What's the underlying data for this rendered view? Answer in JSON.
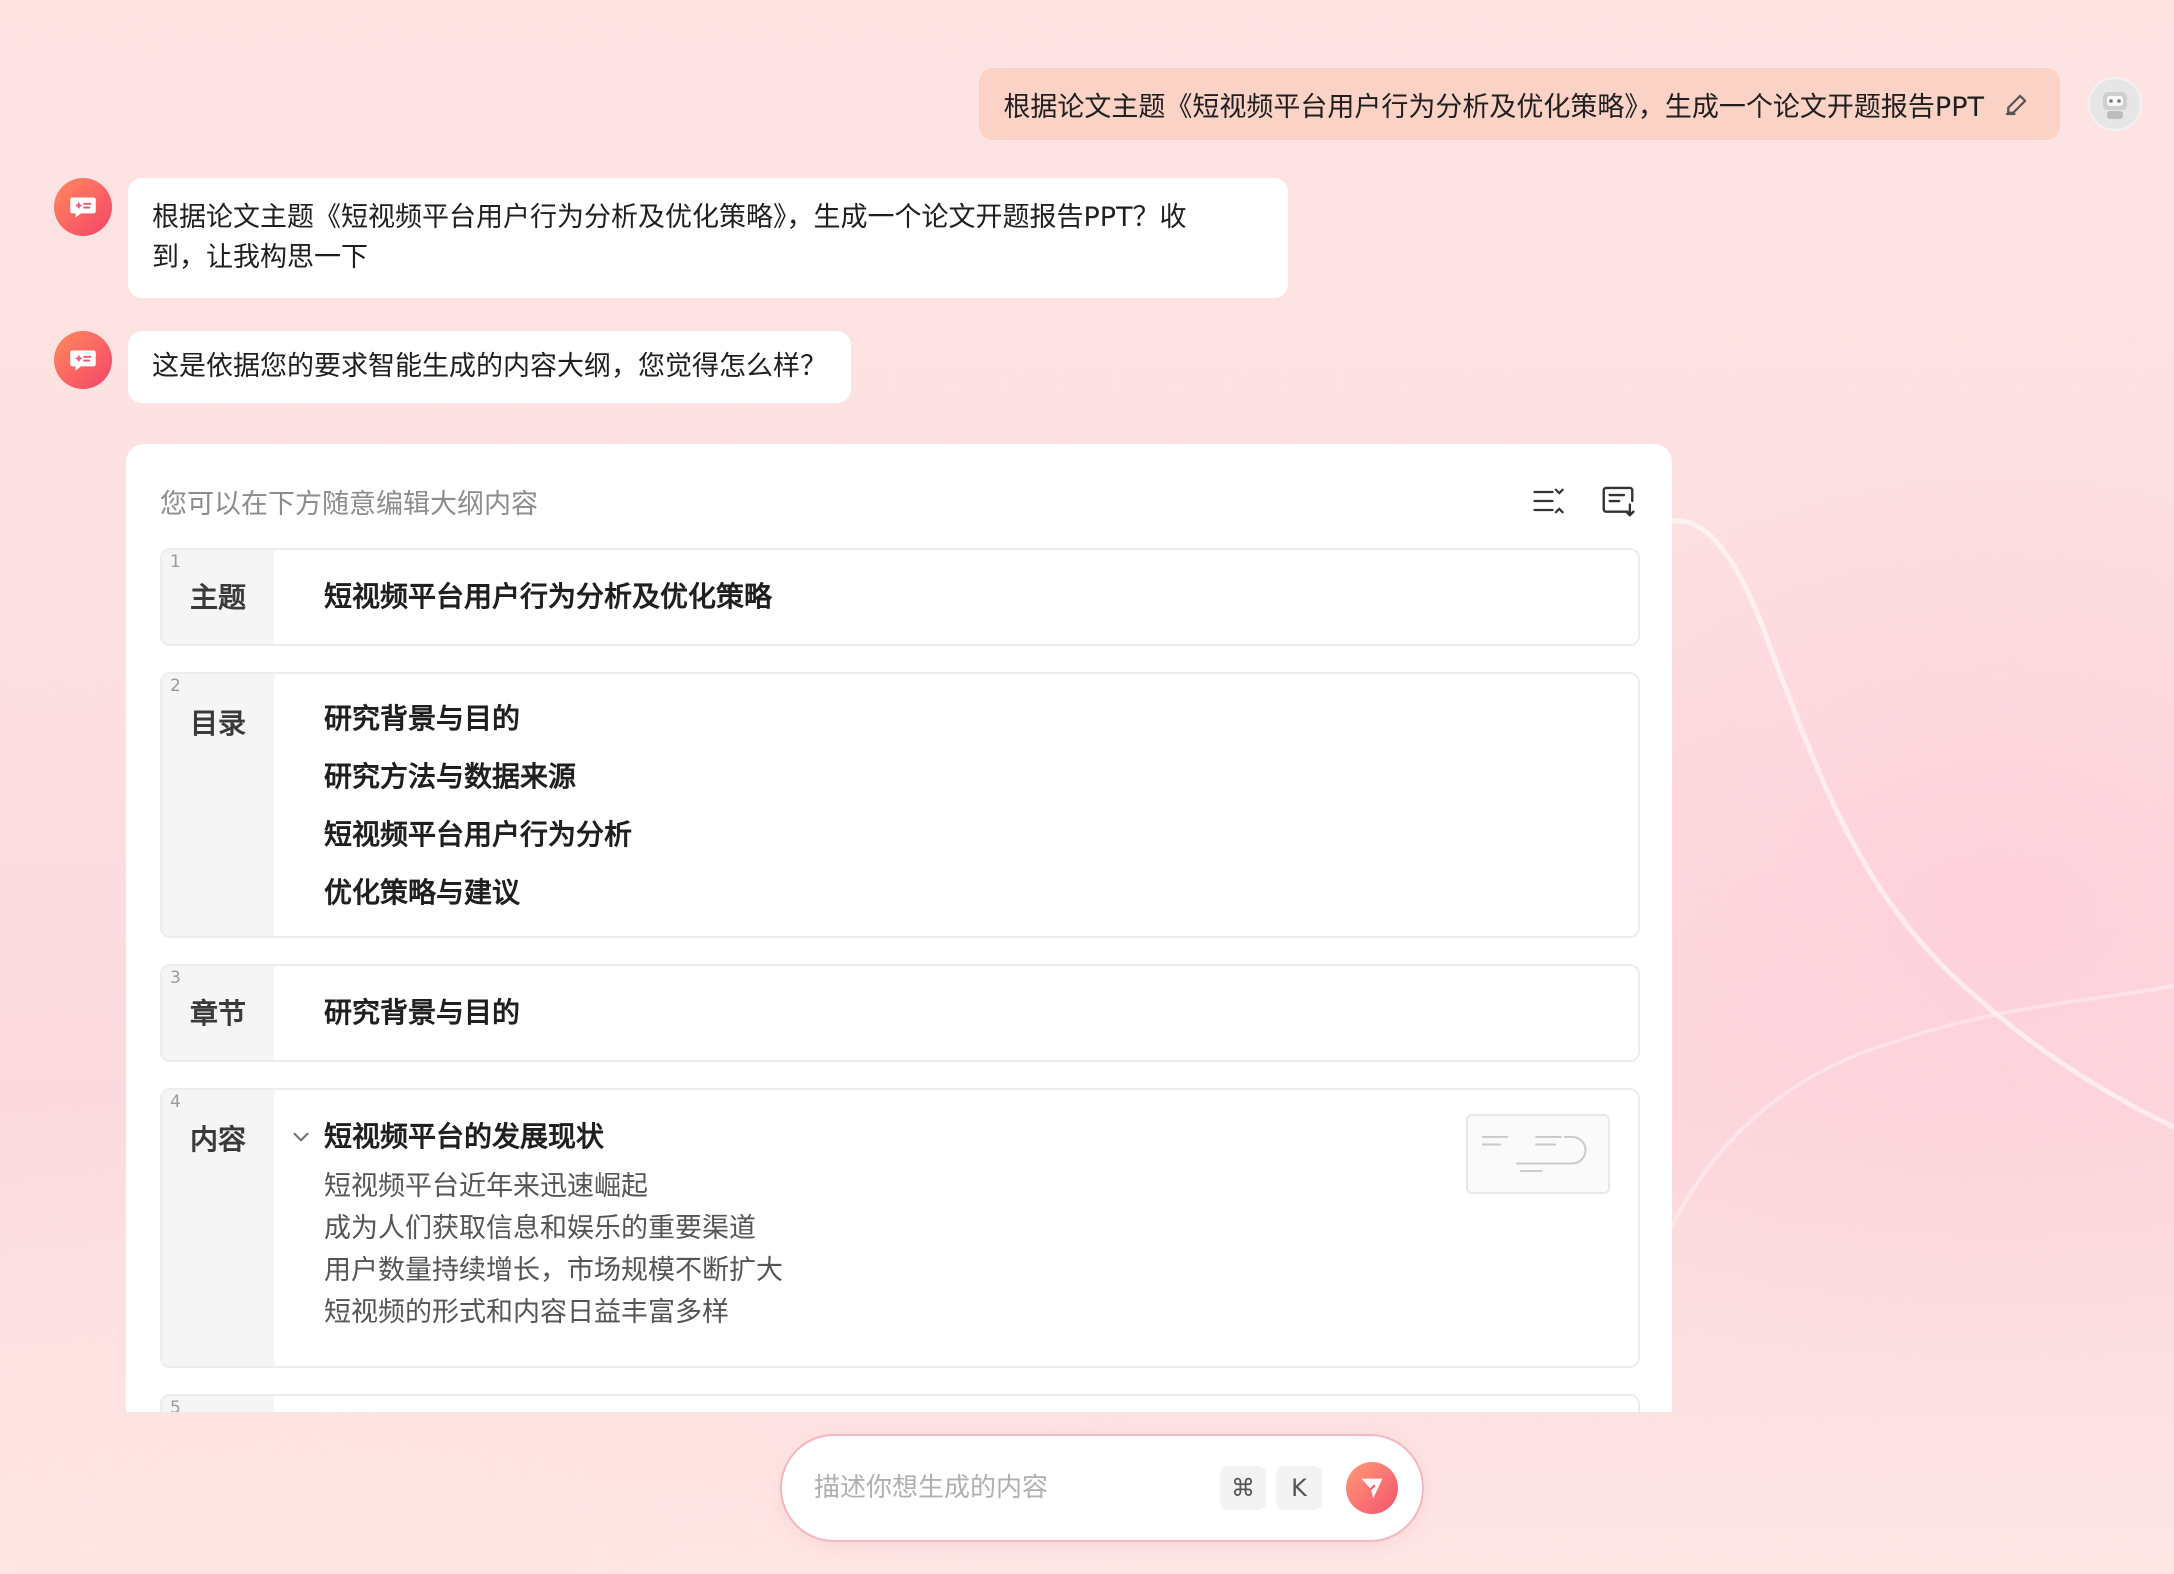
{
  "user_message": {
    "text": "根据论文主题《短视频平台用户行为分析及优化策略》，生成一个论文开题报告PPT",
    "edit_icon": "pencil-icon",
    "avatar_icon": "robot-avatar-icon"
  },
  "bot_messages": [
    {
      "line1": "根据论文主题《短视频平台用户行为分析及优化策略》，生成一个论文开题报告PPT？收",
      "line2": "到，让我构思一下"
    },
    {
      "line1": "这是依据您的要求智能生成的内容大纲，您觉得怎么样？"
    }
  ],
  "outline": {
    "hint": "您可以在下方随意编辑大纲内容",
    "tools": [
      "collapse-all-icon",
      "export-outline-icon"
    ],
    "sections": [
      {
        "num": "1",
        "label": "主题",
        "lines": [
          "短视频平台用户行为分析及优化策略"
        ]
      },
      {
        "num": "2",
        "label": "目录",
        "lines": [
          "研究背景与目的",
          "研究方法与数据来源",
          "短视频平台用户行为分析",
          "优化策略与建议"
        ]
      },
      {
        "num": "3",
        "label": "章节",
        "lines": [
          "研究背景与目的"
        ]
      },
      {
        "num": "4",
        "label": "内容",
        "heading": "短视频平台的发展现状",
        "subs": [
          "短视频平台近年来迅速崛起",
          "成为人们获取信息和娱乐的重要渠道",
          "用户数量持续增长，市场规模不断扩大",
          "短视频的形式和内容日益丰富多样"
        ]
      },
      {
        "num": "5"
      }
    ]
  },
  "input": {
    "placeholder": "描述你想生成的内容",
    "kbd_cmd": "⌘",
    "kbd_key": "K",
    "send_icon": "send-icon"
  },
  "colors": {
    "accent": "#f5536f",
    "user_bubble": "#fad2c6"
  }
}
